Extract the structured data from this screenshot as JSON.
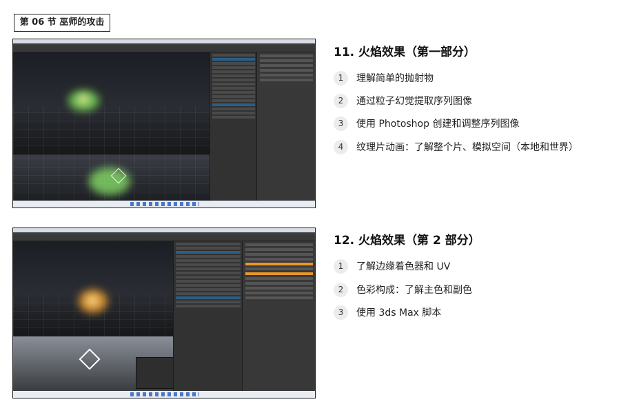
{
  "section_tag": "第 06 节 巫师的攻击",
  "lessons": [
    {
      "title": "11. 火焰效果（第一部分）",
      "items": [
        {
          "num": "1",
          "text": "理解简单的抛射物"
        },
        {
          "num": "2",
          "text": "通过粒子幻觉提取序列图像"
        },
        {
          "num": "3",
          "text": "使用 Photoshop 创建和调整序列图像"
        },
        {
          "num": "4",
          "text": "纹理片动画：了解整个片、模拟空间（本地和世界）"
        }
      ]
    },
    {
      "title": "12. 火焰效果（第 2 部分）",
      "items": [
        {
          "num": "1",
          "text": "了解边缘着色器和 UV"
        },
        {
          "num": "2",
          "text": "色彩构成：了解主色和副色"
        },
        {
          "num": "3",
          "text": "使用 3ds Max 脚本"
        }
      ]
    }
  ],
  "colors": {
    "accent_selection": "#2c5d87",
    "inspector_highlight": "#e8962c",
    "effect_green": "#7de05a",
    "effect_orange": "#f0a030"
  }
}
